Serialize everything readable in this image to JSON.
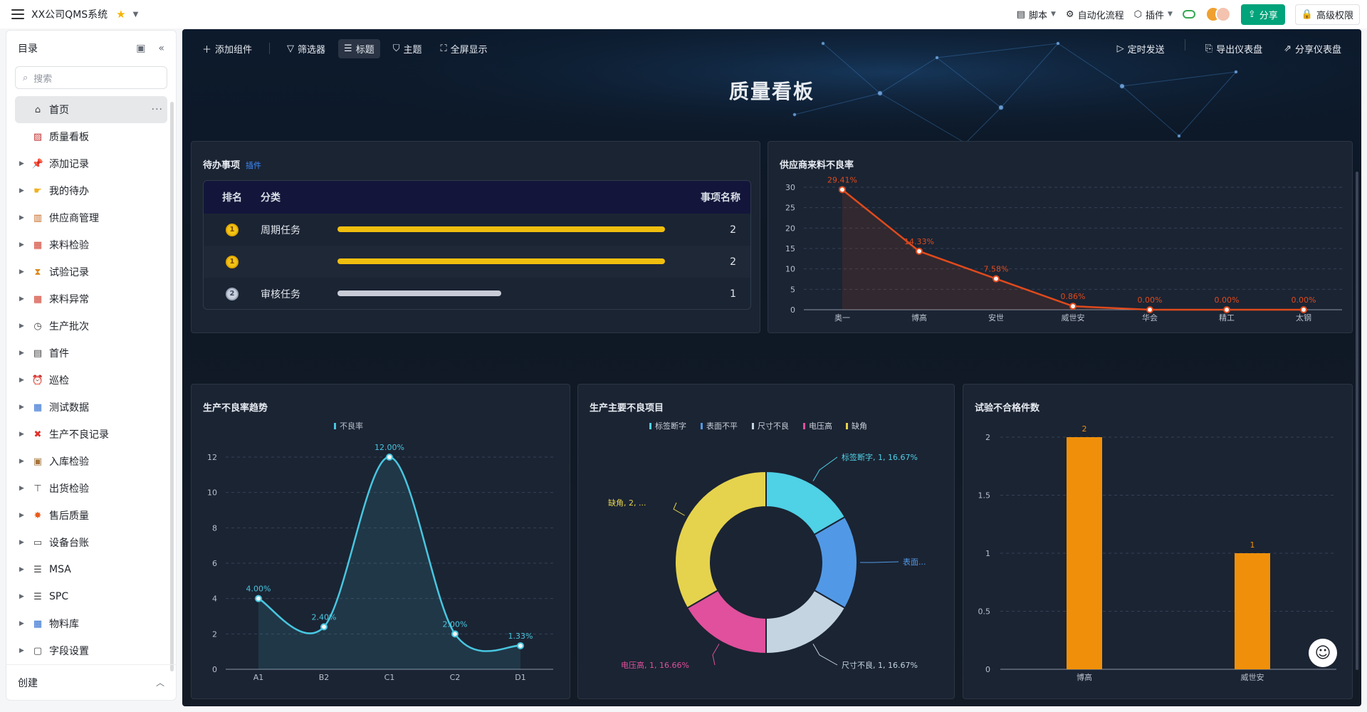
{
  "app": {
    "title": "XX公司QMS系统"
  },
  "topbar": {
    "script": "脚本",
    "automation": "自动化流程",
    "plugin": "插件",
    "share": "分享",
    "permission": "高级权限"
  },
  "sidebar": {
    "title": "目录",
    "search_placeholder": "搜索",
    "items": [
      {
        "label": "首页",
        "icon": "home-icon"
      },
      {
        "label": "质量看板",
        "icon": "dashboard-icon"
      },
      {
        "label": "添加记录",
        "icon": "pin-icon"
      },
      {
        "label": "我的待办",
        "icon": "hand-icon"
      },
      {
        "label": "供应商管理",
        "icon": "factory-icon"
      },
      {
        "label": "来料检验",
        "icon": "calendar-icon"
      },
      {
        "label": "试验记录",
        "icon": "hourglass-icon"
      },
      {
        "label": "来料异常",
        "icon": "calendar-icon"
      },
      {
        "label": "生产批次",
        "icon": "watch-icon"
      },
      {
        "label": "首件",
        "icon": "document-icon"
      },
      {
        "label": "巡检",
        "icon": "alarm-icon"
      },
      {
        "label": "测试数据",
        "icon": "grid-icon"
      },
      {
        "label": "生产不良记录",
        "icon": "cross-icon"
      },
      {
        "label": "入库检验",
        "icon": "box-icon"
      },
      {
        "label": "出货检验",
        "icon": "sign-icon"
      },
      {
        "label": "售后质量",
        "icon": "burst-icon"
      },
      {
        "label": "设备台账",
        "icon": "laptop-icon"
      },
      {
        "label": "MSA",
        "icon": "list-icon"
      },
      {
        "label": "SPC",
        "icon": "list-icon"
      },
      {
        "label": "物料库",
        "icon": "grid-icon"
      },
      {
        "label": "字段设置",
        "icon": "folder-icon"
      }
    ],
    "footer": "创建"
  },
  "dashboard": {
    "title": "质量看板",
    "toolbar": {
      "add_widget": "添加组件",
      "filter": "筛选器",
      "heading": "标题",
      "theme": "主题",
      "fullscreen": "全屏显示",
      "schedule": "定时发送",
      "export": "导出仪表盘",
      "share": "分享仪表盘"
    },
    "todo": {
      "title": "待办事项",
      "tag": "插件",
      "headers": [
        "排名",
        "分类",
        "事项名称"
      ],
      "rows": [
        {
          "rank": "1",
          "category": "周期任务",
          "value": "2",
          "fraction": 1.0,
          "style": "gold"
        },
        {
          "rank": "1",
          "category": "",
          "value": "2",
          "fraction": 1.0,
          "style": "gold"
        },
        {
          "rank": "2",
          "category": "审核任务",
          "value": "1",
          "fraction": 0.5,
          "style": "silver"
        }
      ]
    }
  },
  "chart_data": [
    {
      "id": "supplier",
      "title": "供应商来料不良率",
      "type": "line",
      "categories": [
        "奥一",
        "博高",
        "安世",
        "威世安",
        "华会",
        "精工",
        "太钢"
      ],
      "values": [
        29.41,
        14.33,
        7.58,
        0.86,
        0,
        0,
        0
      ],
      "labels": [
        "29.41%",
        "14.33%",
        "7.58%",
        "0.86%",
        "0.00%",
        "0.00%",
        "0.00%"
      ],
      "ylim": [
        0,
        30
      ],
      "yticks": [
        0,
        5,
        10,
        15,
        20,
        25,
        30
      ],
      "color": "#e04a1c",
      "grid": true
    },
    {
      "id": "trend",
      "title": "生产不良率趋势",
      "type": "line",
      "legend": "不良率",
      "categories": [
        "A1",
        "B2",
        "C1",
        "C2",
        "D1"
      ],
      "values": [
        4.0,
        2.4,
        12.0,
        2.0,
        1.33
      ],
      "labels": [
        "4.00%",
        "2.40%",
        "12.00%",
        "2.00%",
        "1.33%"
      ],
      "ylim": [
        0,
        12
      ],
      "yticks": [
        0,
        2,
        4,
        6,
        8,
        10,
        12
      ],
      "color": "#48c6e0",
      "grid": true
    },
    {
      "id": "defects",
      "title": "生产主要不良项目",
      "type": "pie",
      "legend": [
        "标签断字",
        "表面不平",
        "尺寸不良",
        "电压高",
        "缺角"
      ],
      "slices": [
        {
          "name": "标签断字",
          "value": 1,
          "percent": "16.67%",
          "label": "标签断字, 1, 16.67%",
          "color": "#4fd1e6"
        },
        {
          "name": "表面不平",
          "value": 1,
          "percent": "16.67%",
          "label": "表面...",
          "color": "#5199e6"
        },
        {
          "name": "尺寸不良",
          "value": 1,
          "percent": "16.67%",
          "label": "尺寸不良, 1, 16.67%",
          "color": "#c4d4e0"
        },
        {
          "name": "电压高",
          "value": 1,
          "percent": "16.66%",
          "label": "电压高, 1, 16.66%",
          "color": "#e0509c"
        },
        {
          "name": "缺角",
          "value": 2,
          "percent": "33.33%",
          "label": "缺角, 2, ...",
          "color": "#e5d34d"
        }
      ]
    },
    {
      "id": "tests",
      "title": "试验不合格件数",
      "type": "bar",
      "categories": [
        "博高",
        "威世安"
      ],
      "values": [
        2,
        1
      ],
      "labels": [
        "2",
        "1"
      ],
      "ylim": [
        0,
        2
      ],
      "yticks": [
        "0",
        "0.5",
        "1",
        "1.5",
        "2"
      ],
      "color": "#f0900a",
      "grid": true
    }
  ]
}
